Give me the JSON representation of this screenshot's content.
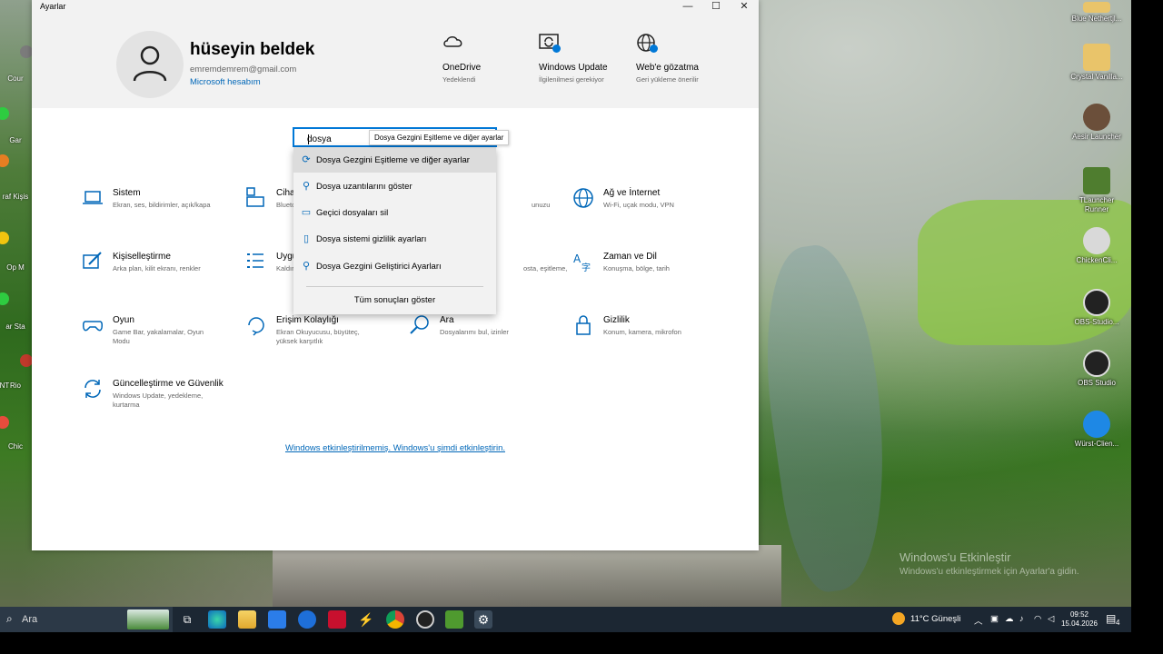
{
  "window": {
    "title": "Ayarlar",
    "controls": {
      "minimize": "—",
      "maximize": "☐",
      "close": "✕"
    }
  },
  "account": {
    "name": "hüseyin beldek",
    "email": "emremdemrem@gmail.com",
    "link": "Microsoft hesabım"
  },
  "header_items": [
    {
      "title": "OneDrive",
      "subtitle": "Yedeklendi",
      "icon": "cloud-icon"
    },
    {
      "title": "Windows Update",
      "subtitle": "İlgilenilmesi gerekiyor",
      "icon": "sync-icon"
    },
    {
      "title": "Web'e gözatma",
      "subtitle": "Geri yükleme önerilir",
      "icon": "globe-icon"
    }
  ],
  "search": {
    "value": "dosya",
    "tooltip": "Dosya Gezgini Eşitleme ve diğer ayarlar",
    "results": [
      {
        "label": "Dosya Gezgini Eşitleme ve diğer ayarlar",
        "icon": "sync-icon"
      },
      {
        "label": "Dosya uzantılarını göster",
        "icon": "tool-icon"
      },
      {
        "label": "Geçici dosyaları sil",
        "icon": "drive-icon"
      },
      {
        "label": "Dosya sistemi gizlilik ayarları",
        "icon": "document-icon"
      },
      {
        "label": "Dosya Gezgini Geliştirici Ayarları",
        "icon": "tool-icon"
      }
    ],
    "show_all": "Tüm sonuçları göster"
  },
  "categories": [
    {
      "title": "Sistem",
      "desc": "Ekran, ses, bildirimler, açık/kapa",
      "icon": "laptop-icon"
    },
    {
      "title": "Cihaz",
      "desc": "Blueto",
      "icon": "keyboard-icon"
    },
    {
      "title": "",
      "desc": "unuzu",
      "icon": "phone-icon"
    },
    {
      "title": "Ağ ve İnternet",
      "desc": "Wi-Fi, uçak modu, VPN",
      "icon": "globe-icon"
    },
    {
      "title": "Kişiselleştirme",
      "desc": "Arka plan, kilit ekranı, renkler",
      "icon": "brush-icon"
    },
    {
      "title": "Uygu",
      "desc": "Kaldır",
      "icon": "list-icon"
    },
    {
      "title": "",
      "desc": "osta, eşitleme,",
      "icon": "person-icon"
    },
    {
      "title": "Zaman ve Dil",
      "desc": "Konuşma, bölge, tarih",
      "icon": "language-icon"
    },
    {
      "title": "Oyun",
      "desc": "Game Bar, yakalamalar, Oyun Modu",
      "icon": "gamepad-icon"
    },
    {
      "title": "Erişim Kolaylığı",
      "desc": "Ekran Okuyucusu, büyüteç, yüksek karşıtlık",
      "icon": "accessibility-icon"
    },
    {
      "title": "Ara",
      "desc": "Dosyalarımı bul, izinler",
      "icon": "search-icon"
    },
    {
      "title": "Gizlilik",
      "desc": "Konum, kamera, mikrofon",
      "icon": "lock-icon"
    },
    {
      "title": "Güncelleştirme ve Güvenlik",
      "desc": "Windows Update, yedekleme, kurtarma",
      "icon": "sync-icon"
    }
  ],
  "activation_link": "Windows etkinleştirilmemiş. Windows'u şimdi etkinleştirin.",
  "watermark": {
    "title": "Windows'u Etkinleştir",
    "text": "Windows'u etkinleştirmek için Ayarlar'a gidin."
  },
  "desktop_icons": [
    {
      "label": "Blue Nethertjl...",
      "color": "#e9c46a"
    },
    {
      "label": "Crystal Vanilla...",
      "color": "#e9c46a"
    },
    {
      "label": "Aesir Launcher",
      "color": "#6b4f3a"
    },
    {
      "label": "TLauncher Runner",
      "color": "#4f7d2f"
    },
    {
      "label": "ChickenCli...",
      "color": "#d9d9d9"
    },
    {
      "label": "OBS-Studio...",
      "color": "#222222"
    },
    {
      "label": "OBS Studio",
      "color": "#222222"
    },
    {
      "label": "Würst-Clien...",
      "color": "#1e88e5"
    }
  ],
  "left_icons": [
    "Cour",
    "Gar",
    "raf Kişis",
    "Op M",
    "ar Sta",
    "Rio",
    "NT",
    "Chic"
  ],
  "taskbar": {
    "search_placeholder": "Ara",
    "weather": "11°C Güneşli",
    "time": "09:52",
    "date": "15.04.2026",
    "notification_count": "4"
  }
}
